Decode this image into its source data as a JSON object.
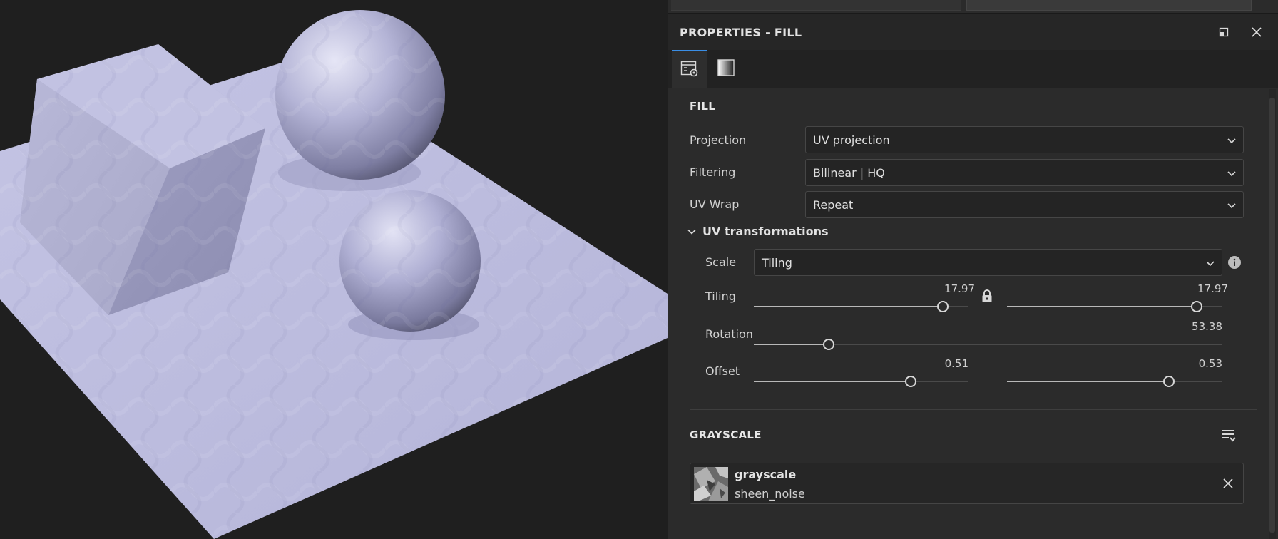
{
  "panel": {
    "title": "PROPERTIES - FILL",
    "header_icons": [
      "maximize-icon",
      "close-icon"
    ],
    "tabs": [
      {
        "name": "properties-settings-icon",
        "active": true
      },
      {
        "name": "gradient-material-icon",
        "active": false
      }
    ]
  },
  "fill": {
    "section_title": "FILL",
    "projection": {
      "label": "Projection",
      "value": "UV projection"
    },
    "filtering": {
      "label": "Filtering",
      "value": "Bilinear | HQ"
    },
    "uv_wrap": {
      "label": "UV Wrap",
      "value": "Repeat"
    },
    "uv_transformations": {
      "title": "UV transformations",
      "expanded": true,
      "scale": {
        "label": "Scale",
        "value": "Tiling"
      },
      "tiling": {
        "label": "Tiling",
        "value_x": "17.97",
        "value_y": "17.97",
        "locked": true,
        "fraction_x": 0.88,
        "fraction_y": 0.88
      },
      "rotation": {
        "label": "Rotation",
        "value": "53.38",
        "fraction": 0.16
      },
      "offset": {
        "label": "Offset",
        "value_x": "0.51",
        "value_y": "0.53",
        "fraction_x": 0.73,
        "fraction_y": 0.75
      }
    }
  },
  "grayscale": {
    "section_title": "GRAYSCALE",
    "resource": {
      "name": "grayscale",
      "sub": "sheen_noise"
    }
  },
  "colors": {
    "accent": "#3a8ee6",
    "material": "#b8b8dc"
  }
}
